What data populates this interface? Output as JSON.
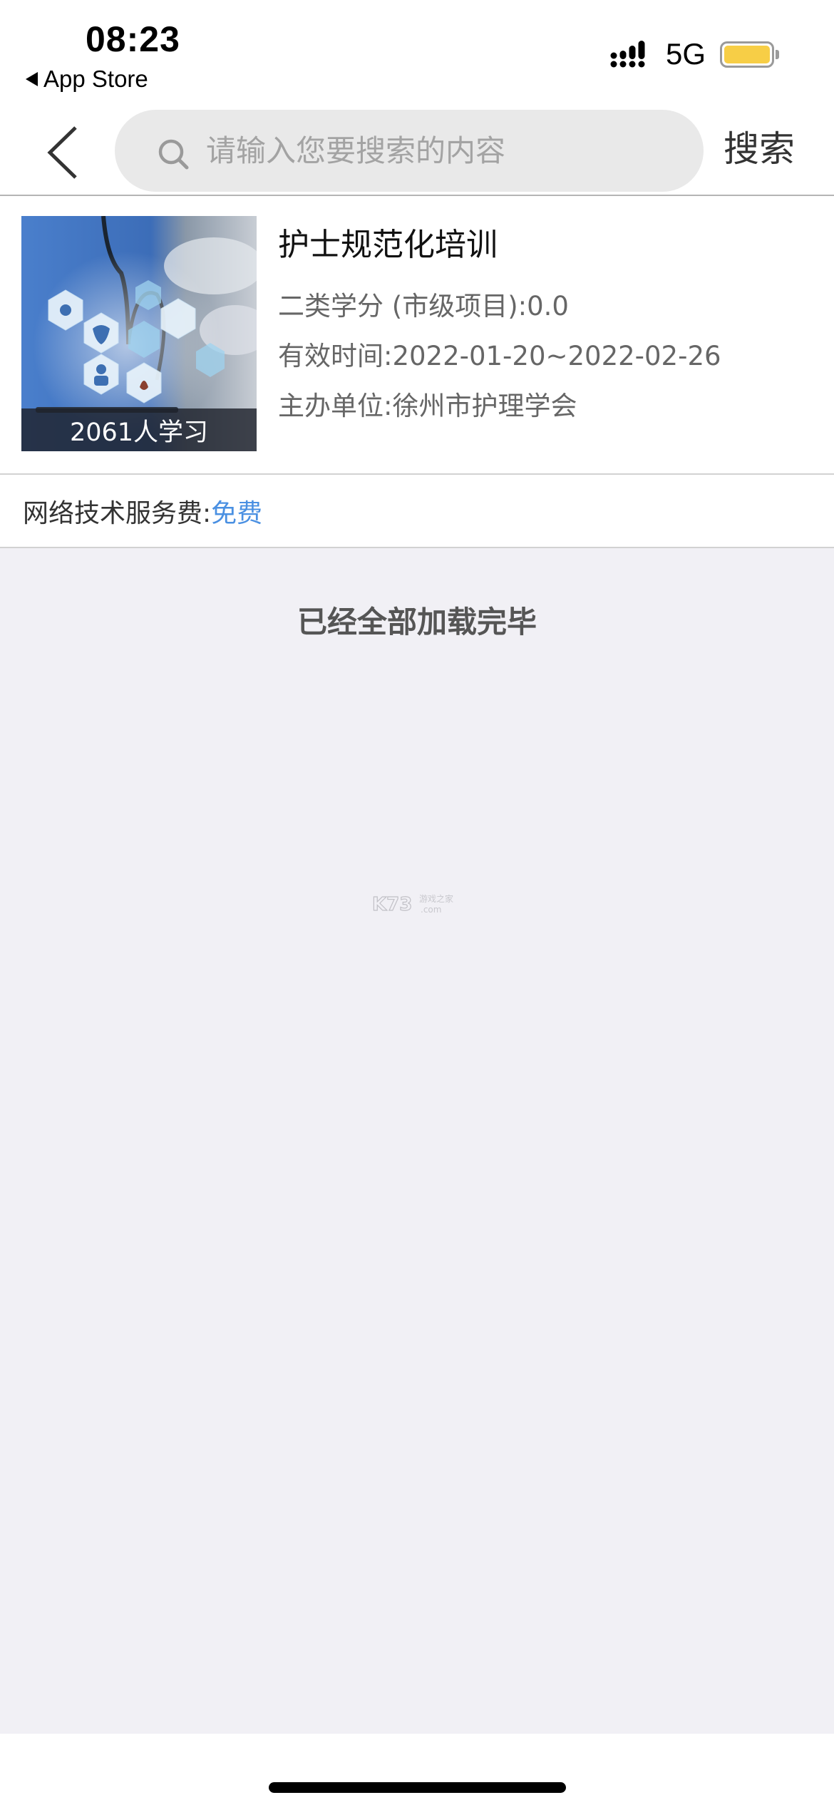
{
  "status_bar": {
    "time": "08:23",
    "back_app_label": "App Store",
    "network": "5G",
    "battery_level": 1.0,
    "battery_color": "#F7CE46"
  },
  "nav": {
    "search_placeholder": "请输入您要搜索的内容",
    "search_value": "",
    "search_button": "搜索"
  },
  "course": {
    "title": "护士规范化培训",
    "learners_badge": "2061人学习",
    "credit_line": "二类学分 (市级项目):0.0",
    "valid_period_line": "有效时间:2022-01-20~2022-02-26",
    "organizer_line": "主办单位:徐州市护理学会"
  },
  "fee": {
    "label": "网络技术服务费:",
    "value": "免费",
    "value_color": "#4A90E2"
  },
  "list_footer": {
    "status_text": "已经全部加载完毕"
  },
  "watermark": {
    "brand": "K73",
    "tagline": "游戏之家",
    "domain": ".com"
  }
}
